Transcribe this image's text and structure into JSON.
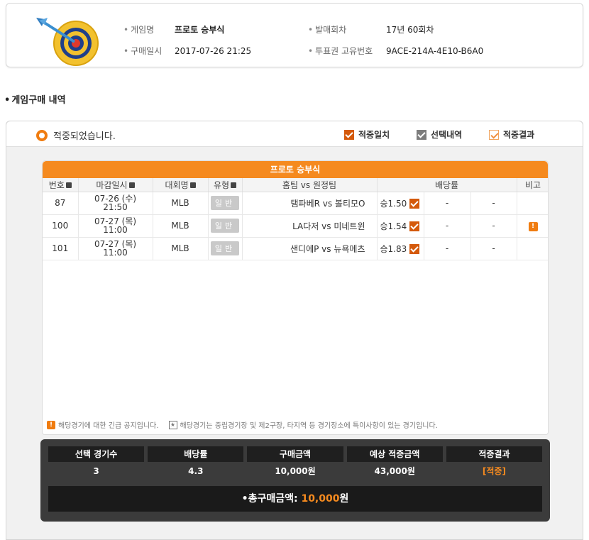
{
  "header": {
    "game_label": "게임명",
    "game_value": "프로토 승부식",
    "round_label": "발매회차",
    "round_value": "17년 60회차",
    "purchase_label": "구매일시",
    "purchase_value": "2017-07-26 21:25",
    "ticket_label": "투표권 고유번호",
    "ticket_value": "9ACE-214A-4E10-B6A0"
  },
  "section_title": "게임구매 내역",
  "status": {
    "win_text": "적중되었습니다.",
    "legend": [
      "적중일치",
      "선택내역",
      "적중결과"
    ]
  },
  "table": {
    "title": "프로토 승부식",
    "columns": [
      "번호",
      "마감일시",
      "대회명",
      "유형",
      "홈팀 vs 원정팀",
      "배당률",
      "비고"
    ],
    "rows": [
      {
        "no": "87",
        "date1": "07-26 (수)",
        "date2": "21:50",
        "league": "MLB",
        "type": "일반",
        "teams": "탬파베R vs 볼티모O",
        "odd": "승1.50",
        "d1": "-",
        "d2": "-",
        "note": ""
      },
      {
        "no": "100",
        "date1": "07-27 (목)",
        "date2": "11:00",
        "league": "MLB",
        "type": "일반",
        "teams": "LA다저 vs 미네트윈",
        "odd": "승1.54",
        "d1": "-",
        "d2": "-",
        "note": "!"
      },
      {
        "no": "101",
        "date1": "07-27 (목)",
        "date2": "11:00",
        "league": "MLB",
        "type": "일반",
        "teams": "샌디에P vs 뉴욕메츠",
        "odd": "승1.83",
        "d1": "-",
        "d2": "-",
        "note": ""
      }
    ],
    "footnote_icon1": "!",
    "footnote1": "해당경기에 대한 긴급 공지입니다.",
    "footnote_icon2": "★",
    "footnote2": "해당경기는 중립경기장 및 제2구장, 타지역 등 경기장소에 특이사항이 있는 경기입니다."
  },
  "summary": {
    "headers": [
      "선택 경기수",
      "배당률",
      "구매금액",
      "예상 적중금액",
      "적중결과"
    ],
    "values": [
      "3",
      "4.3",
      "10,000원",
      "43,000원",
      "[적중]"
    ],
    "total_label": "•총구매금액:",
    "total_amount": "10,000",
    "total_unit": "원"
  }
}
